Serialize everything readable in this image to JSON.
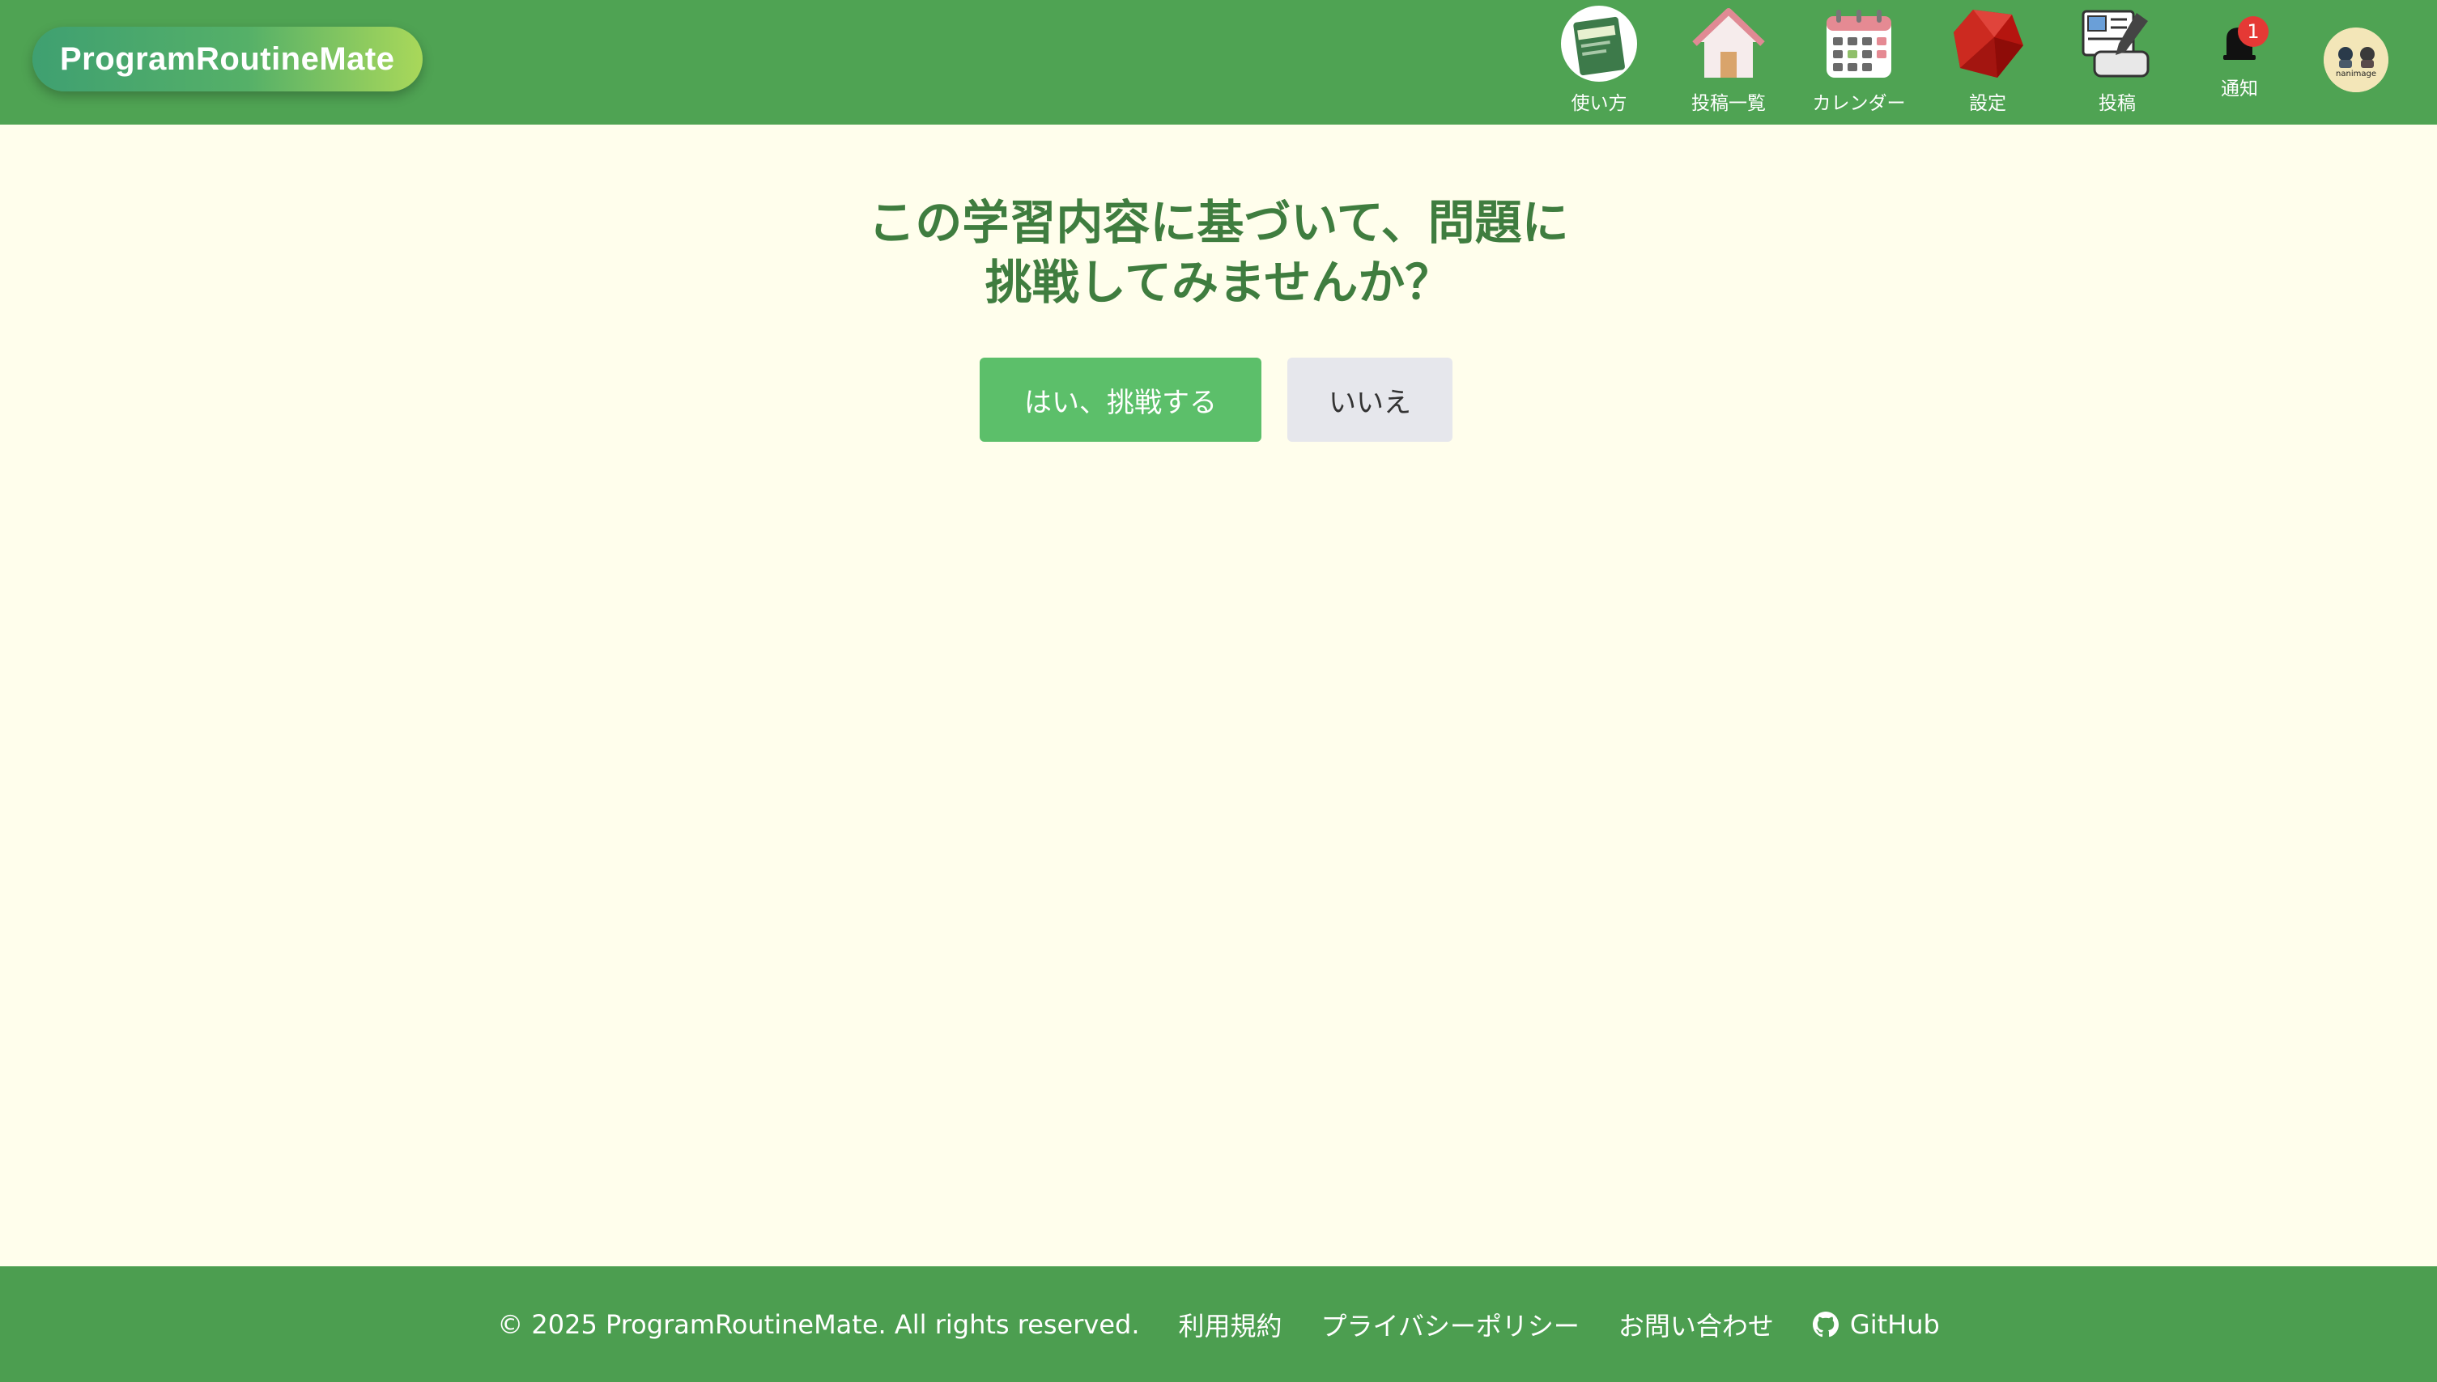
{
  "header": {
    "brand": "ProgramRoutineMate",
    "nav": [
      {
        "label": "使い方",
        "icon": "manual-book-icon"
      },
      {
        "label": "投稿一覧",
        "icon": "house-icon"
      },
      {
        "label": "カレンダー",
        "icon": "calendar-icon"
      },
      {
        "label": "設定",
        "icon": "ruby-gem-icon"
      },
      {
        "label": "投稿",
        "icon": "post-edit-icon"
      }
    ],
    "notification": {
      "label": "通知",
      "count": "1",
      "icon": "bell-icon"
    },
    "avatar_text": "nanimage"
  },
  "main": {
    "question_line1": "この学習内容に基づいて、問題に",
    "question_line2": "挑戦してみませんか？",
    "yes_label": "はい、挑戦する",
    "no_label": "いいえ"
  },
  "footer": {
    "copyright": "© 2025 ProgramRoutineMate. All rights reserved.",
    "terms": "利用規約",
    "privacy": "プライバシーポリシー",
    "contact": "お問い合わせ",
    "github": "GitHub"
  },
  "colors": {
    "header_bg": "#4fa353",
    "page_bg": "#fffeec",
    "title_green": "#3f7d3f",
    "primary_button": "#5cbf6a",
    "secondary_button": "#e6e7ec",
    "badge_red": "#e53935"
  }
}
